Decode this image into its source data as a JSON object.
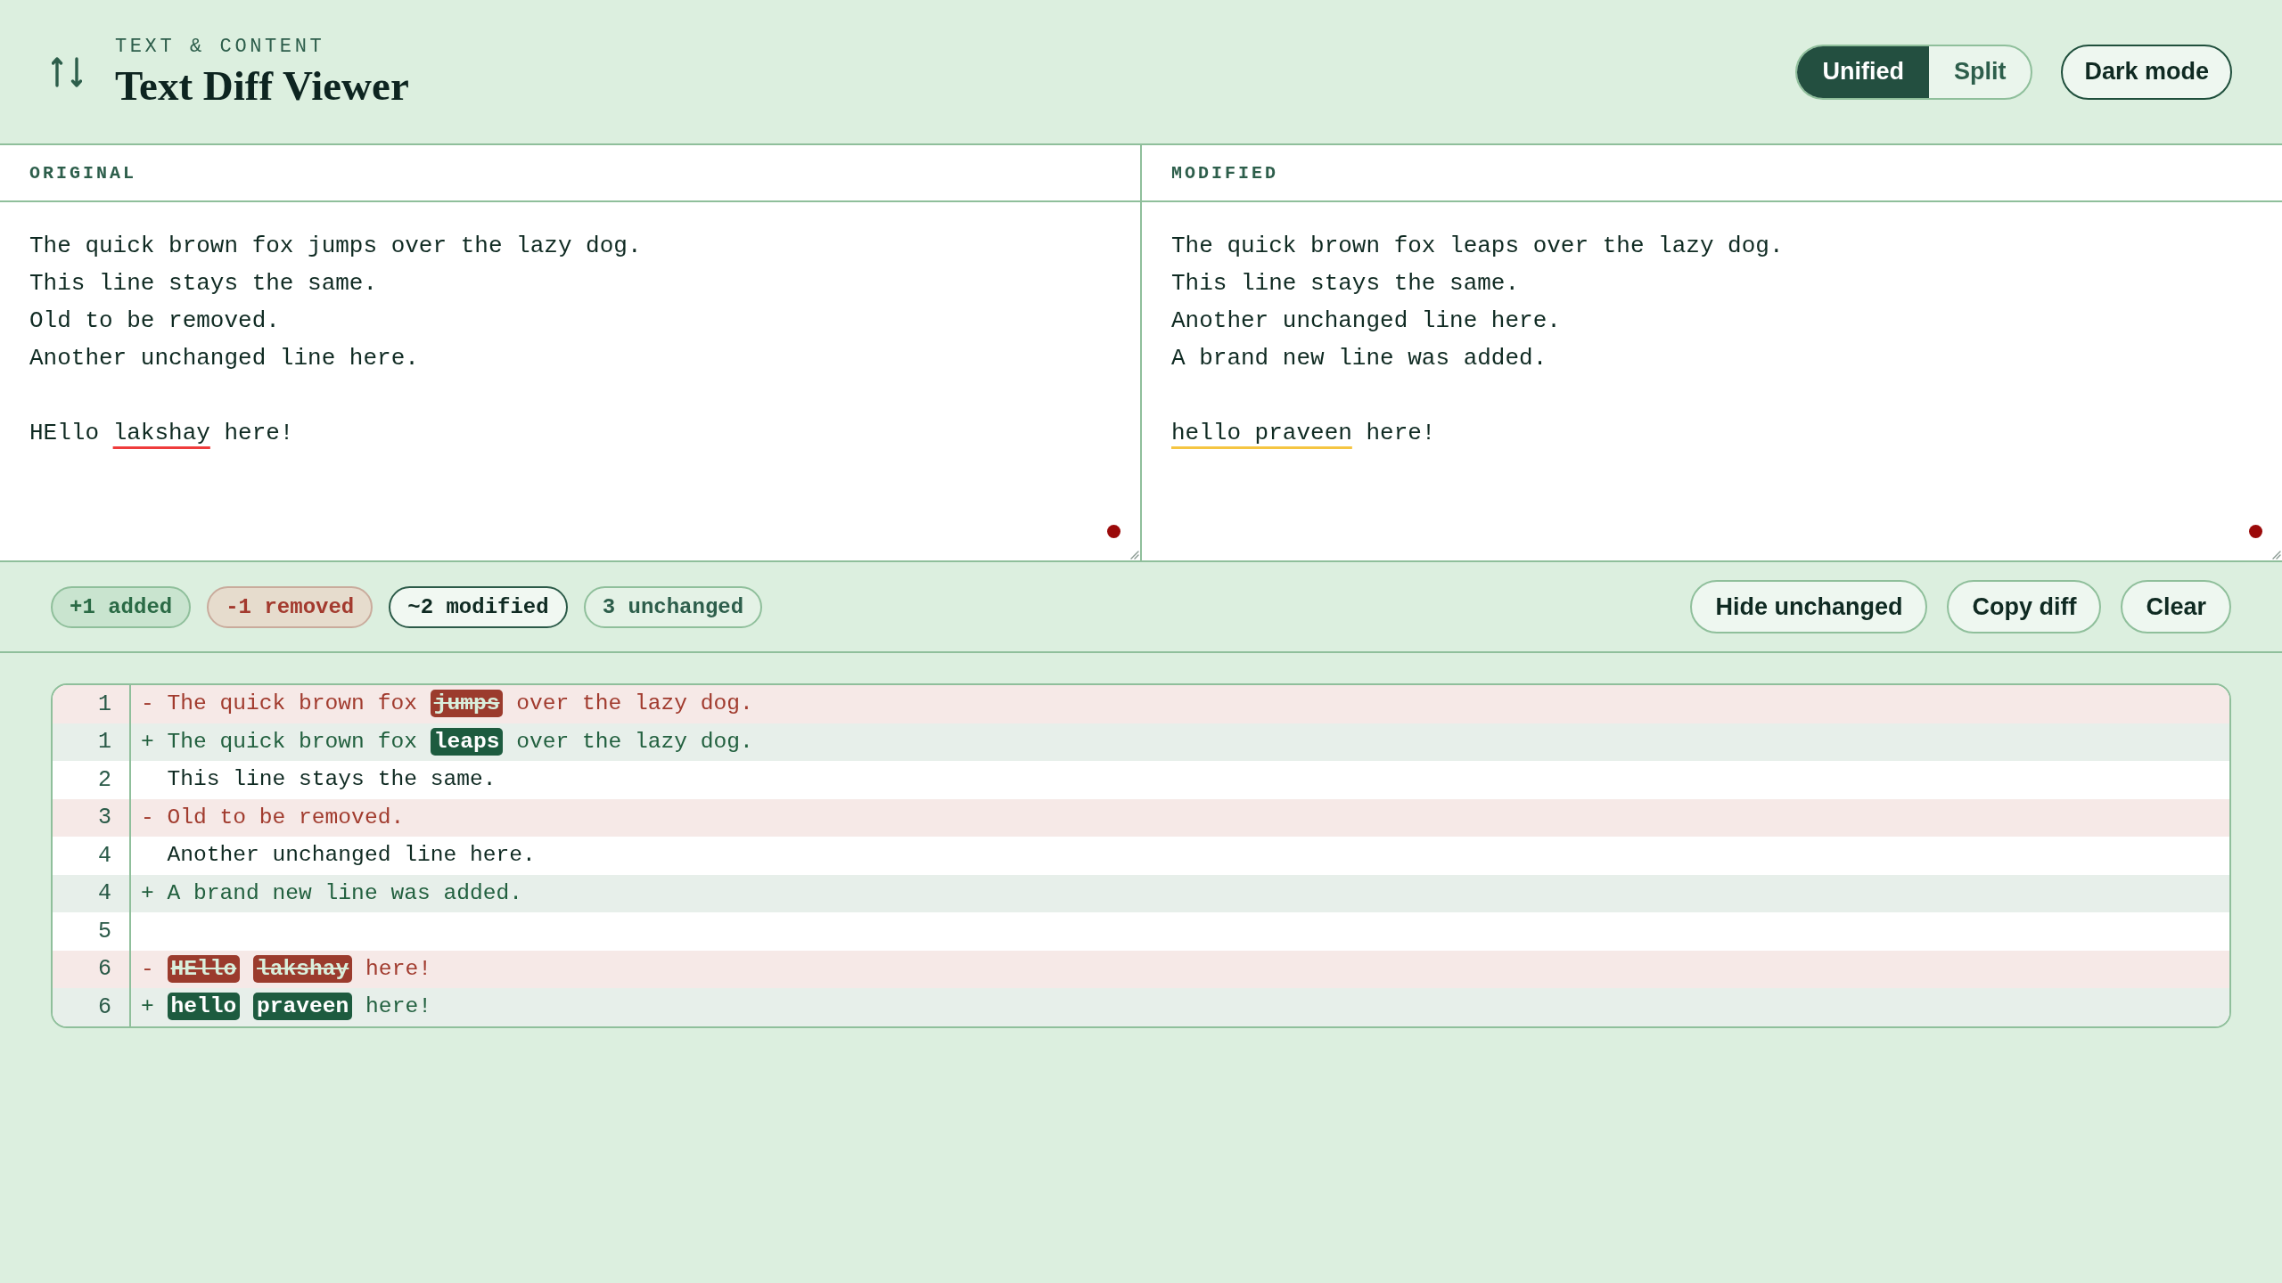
{
  "header": {
    "eyebrow": "TEXT & CONTENT",
    "title": "Text Diff Viewer",
    "view_modes": [
      {
        "label": "Unified",
        "selected": true
      },
      {
        "label": "Split",
        "selected": false
      }
    ],
    "theme_button": {
      "label": "Dark mode"
    }
  },
  "editors": [
    {
      "label": "ORIGINAL",
      "lines": [
        {
          "kind": "text",
          "segments": [
            {
              "kind": "plain",
              "text": "The quick brown fox jumps over the lazy dog."
            }
          ]
        },
        {
          "kind": "text",
          "segments": [
            {
              "kind": "plain",
              "text": "This line stays the same."
            }
          ]
        },
        {
          "kind": "text",
          "segments": [
            {
              "kind": "plain",
              "text": "Old to be removed."
            }
          ]
        },
        {
          "kind": "text",
          "segments": [
            {
              "kind": "plain",
              "text": "Another unchanged line here."
            }
          ]
        },
        {
          "kind": "blank"
        },
        {
          "kind": "text",
          "segments": [
            {
              "kind": "plain",
              "text": "HEllo "
            },
            {
              "kind": "spelling",
              "text": "lakshay"
            },
            {
              "kind": "plain",
              "text": " here!"
            }
          ]
        }
      ]
    },
    {
      "label": "MODIFIED",
      "lines": [
        {
          "kind": "text",
          "segments": [
            {
              "kind": "plain",
              "text": "The quick brown fox leaps over the lazy dog."
            }
          ]
        },
        {
          "kind": "text",
          "segments": [
            {
              "kind": "plain",
              "text": "This line stays the same."
            }
          ]
        },
        {
          "kind": "text",
          "segments": [
            {
              "kind": "plain",
              "text": "Another unchanged line here."
            }
          ]
        },
        {
          "kind": "text",
          "segments": [
            {
              "kind": "plain",
              "text": "A brand new line was added."
            }
          ]
        },
        {
          "kind": "blank"
        },
        {
          "kind": "text",
          "segments": [
            {
              "kind": "grammar",
              "text": "hello praveen"
            },
            {
              "kind": "plain",
              "text": " here!"
            }
          ]
        }
      ]
    }
  ],
  "summary": {
    "stats": [
      {
        "kind": "added",
        "label": "+1 added"
      },
      {
        "kind": "removed",
        "label": "-1 removed"
      },
      {
        "kind": "modified",
        "label": "~2 modified"
      },
      {
        "kind": "unchanged",
        "label": "3 unchanged"
      }
    ],
    "buttons": [
      {
        "label": "Hide unchanged"
      },
      {
        "label": "Copy diff"
      },
      {
        "label": "Clear"
      }
    ]
  },
  "diff": {
    "rows": [
      {
        "kind": "removed",
        "number": "1",
        "sign": "-",
        "segments": [
          {
            "text": "The quick brown fox",
            "changed": false
          },
          {
            "text": "jumps",
            "changed": true
          },
          {
            "text": "over the lazy dog.",
            "changed": false
          }
        ]
      },
      {
        "kind": "added",
        "number": "1",
        "sign": "+",
        "segments": [
          {
            "text": "The quick brown fox",
            "changed": false
          },
          {
            "text": "leaps",
            "changed": true
          },
          {
            "text": "over the lazy dog.",
            "changed": false
          }
        ]
      },
      {
        "kind": "context",
        "number": "2",
        "segments": [
          {
            "text": "This line stays the same.",
            "changed": false
          }
        ]
      },
      {
        "kind": "removed",
        "number": "3",
        "sign": "-",
        "segments": [
          {
            "text": "Old to be removed.",
            "changed": false
          }
        ]
      },
      {
        "kind": "context",
        "number": "4",
        "segments": [
          {
            "text": "Another unchanged line here.",
            "changed": false
          }
        ]
      },
      {
        "kind": "added",
        "number": "4",
        "sign": "+",
        "segments": [
          {
            "text": "A brand new line was added.",
            "changed": false
          }
        ]
      },
      {
        "kind": "context",
        "number": "5"
      },
      {
        "kind": "removed",
        "number": "6",
        "sign": "-",
        "segments": [
          {
            "text": "HEllo",
            "changed": true
          },
          {
            "text": "lakshay",
            "changed": true
          },
          {
            "text": "here!",
            "changed": false
          }
        ]
      },
      {
        "kind": "added",
        "number": "6",
        "sign": "+",
        "segments": [
          {
            "text": "hello",
            "changed": true
          },
          {
            "text": "praveen",
            "changed": true
          },
          {
            "text": "here!",
            "changed": false
          }
        ]
      }
    ]
  }
}
